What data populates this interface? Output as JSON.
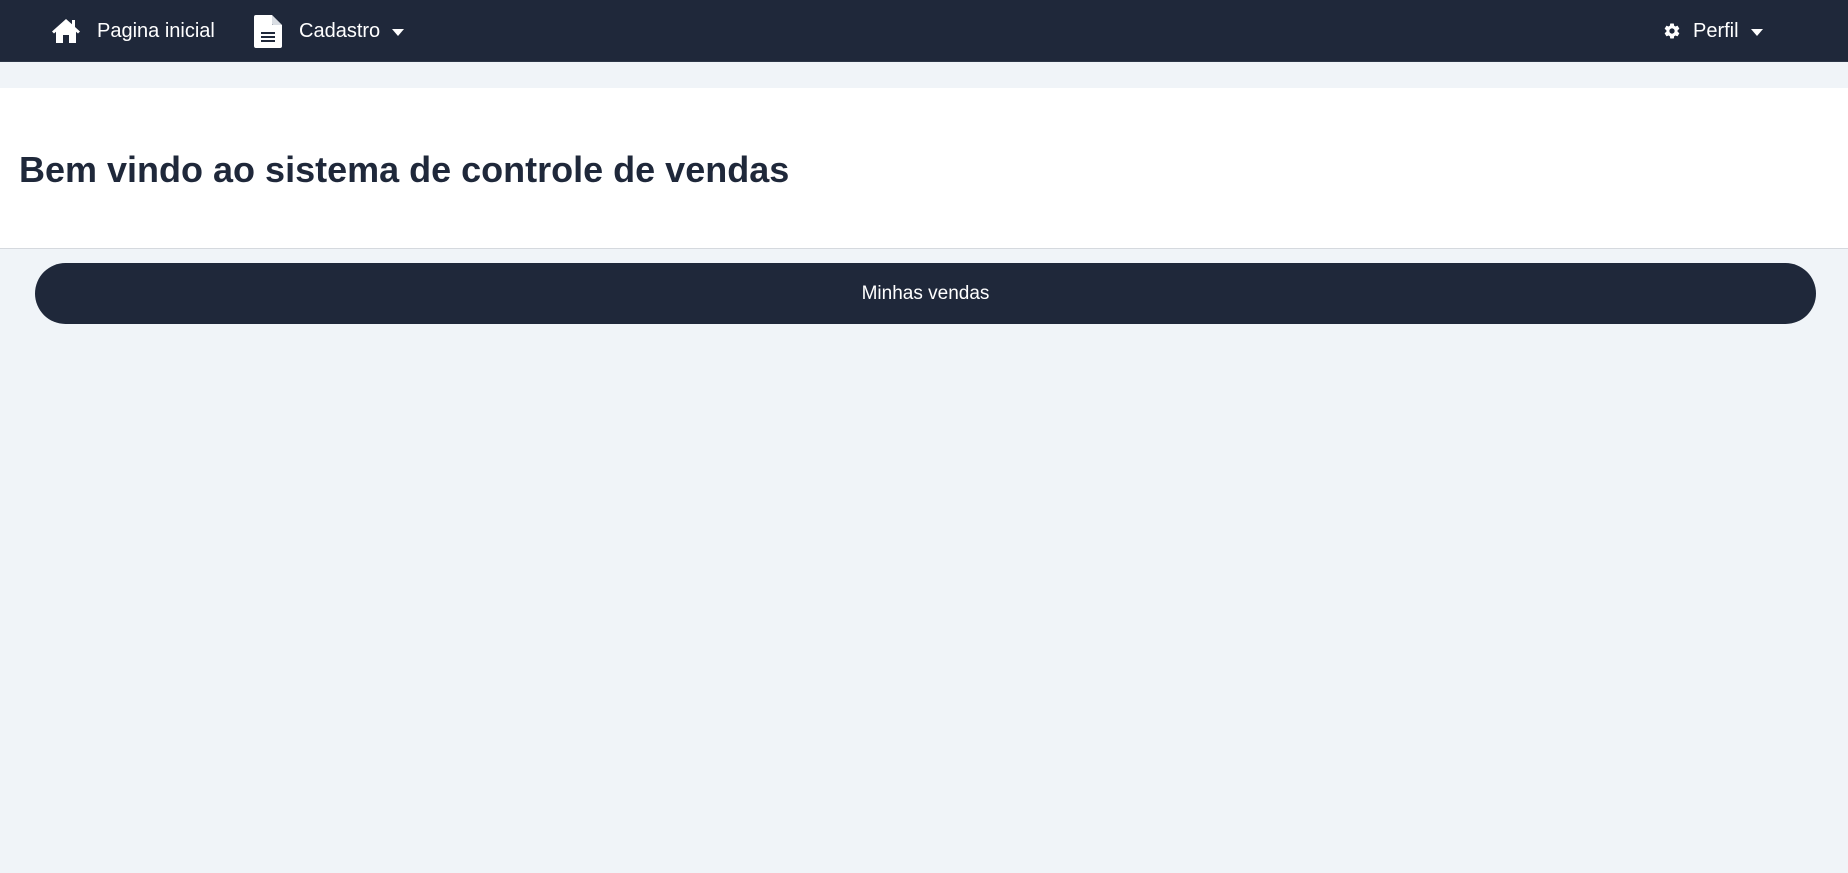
{
  "navbar": {
    "home": {
      "label": "Pagina inicial",
      "icon": "home-icon"
    },
    "cadastro": {
      "label": "Cadastro",
      "icon": "document-icon",
      "dropdown": true
    },
    "perfil": {
      "label": "Perfil",
      "icon": "gear-icon",
      "dropdown": true
    }
  },
  "main": {
    "welcome_title": "Bem vindo ao sistema de controle de vendas",
    "sales_button_label": "Minhas vendas"
  },
  "colors": {
    "navbar_bg": "#1f283a",
    "page_bg": "#f0f4f8",
    "hero_bg": "#ffffff",
    "title_text": "#1f283a",
    "button_bg": "#1f283a",
    "button_text": "#ffffff"
  }
}
